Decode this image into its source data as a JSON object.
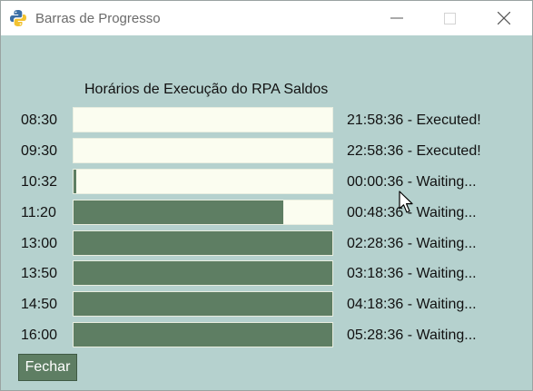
{
  "window": {
    "title": "Barras de Progresso",
    "background_color": "#b5d1ce",
    "icons": {
      "app": "python-icon",
      "minimize": "minimize-icon",
      "maximize": "maximize-icon",
      "close": "close-icon"
    }
  },
  "main": {
    "heading": "Horários de Execução do RPA Saldos",
    "rows": [
      {
        "time": "08:30",
        "progress": 0.0,
        "status": "21:58:36 - Executed!"
      },
      {
        "time": "09:30",
        "progress": 0.0,
        "status": "22:58:36 - Executed!"
      },
      {
        "time": "10:32",
        "progress": 0.01,
        "status": "00:00:36 - Waiting..."
      },
      {
        "time": "11:20",
        "progress": 0.81,
        "status": "00:48:36 - Waiting..."
      },
      {
        "time": "13:00",
        "progress": 1.0,
        "status": "02:28:36 - Waiting..."
      },
      {
        "time": "13:50",
        "progress": 1.0,
        "status": "03:18:36 - Waiting..."
      },
      {
        "time": "14:50",
        "progress": 1.0,
        "status": "04:18:36 - Waiting..."
      },
      {
        "time": "16:00",
        "progress": 1.0,
        "status": "05:28:36 - Waiting..."
      }
    ],
    "colors": {
      "bar_fill": "#5e7e63",
      "bar_track": "#fbfdf0"
    }
  },
  "footer": {
    "close_button_label": "Fechar"
  }
}
